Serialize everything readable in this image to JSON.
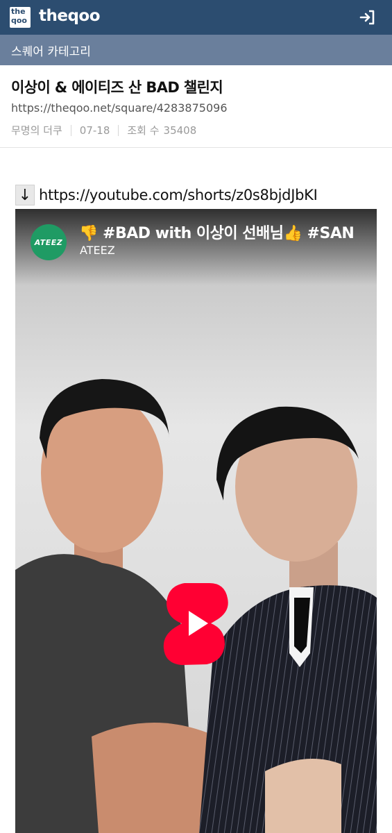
{
  "header": {
    "logo_top": "the",
    "logo_bottom": "qoo",
    "brand": "theqoo",
    "login_icon": "login-icon"
  },
  "category": {
    "label": "스퀘어 카테고리"
  },
  "post": {
    "title": "이상이 & 에이티즈 산 BAD 챌린지",
    "url": "https://theqoo.net/square/4283875096",
    "author": "무명의 더쿠",
    "date": "07-18",
    "views_label": "조회 수",
    "views": "35408"
  },
  "content": {
    "arrow": "↓",
    "link": "https://youtube.com/shorts/z0s8bjdJbKI"
  },
  "video": {
    "title": "👎 #BAD with 이상이 선배님👍 #SAN",
    "channel": "ATEEZ",
    "avatar_text": "ATEEZ",
    "play_icon": "youtube-shorts-play-icon"
  },
  "colors": {
    "topbar": "#2c4d70",
    "catbar": "#6a7f9c",
    "shorts_red": "#ff0033",
    "ateez_green": "#1f9b64"
  }
}
